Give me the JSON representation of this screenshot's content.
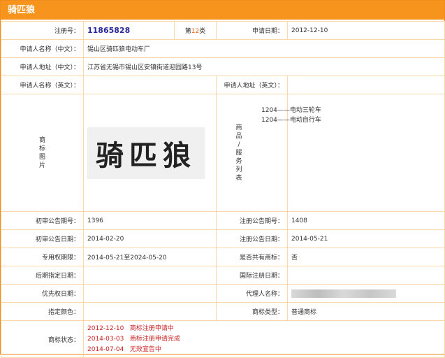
{
  "title": "骑匹狼",
  "fields": {
    "reg_no_label": "注册号：",
    "reg_no": "11865828",
    "class_prefix": "第",
    "class_num": "12",
    "class_suffix": "类",
    "app_date_label": "申请日期：",
    "app_date": "2012-12-10",
    "applicant_cn_label": "申请人名称（中文）：",
    "applicant_cn": "锡山区骑匹狼电动车厂",
    "address_cn_label": "申请人地址（中文）：",
    "address_cn": "江苏省无锡市锡山区安镇街道迎园路13号",
    "applicant_en_label": "申请人名称（英文）：",
    "applicant_en": "",
    "address_en_label": "申请人地址（英文）：",
    "address_en": "",
    "trademark_image_label": [
      "商",
      "标",
      "图",
      "片"
    ],
    "trademark_text": "骑匹狼",
    "goods_label": [
      "商",
      "品",
      "/",
      "服",
      "务",
      "列",
      "表"
    ],
    "goods": [
      "1204——电动三轮车",
      "1204——电动自行车"
    ],
    "prelim_no_label": "初审公告期号：",
    "prelim_no": "1396",
    "reg_pub_no_label": "注册公告期号：",
    "reg_pub_no": "1408",
    "prelim_date_label": "初审公告日期：",
    "prelim_date": "2014-02-20",
    "reg_pub_date_label": "注册公告日期：",
    "reg_pub_date": "2014-05-21",
    "exclusive_label": "专用权期限：",
    "exclusive": "2014-05-21至2024-05-20",
    "shared_label": "是否共有商标：",
    "shared": "否",
    "later_date_label": "后期指定日期：",
    "later_date": "",
    "intl_date_label": "国际注册日期：",
    "intl_date": "",
    "priority_label": "优先权日期：",
    "priority": "",
    "agent_label": "代理人名称：",
    "color_label": "指定颜色：",
    "color": "",
    "tm_type_label": "商标类型：",
    "tm_type": "普通商标",
    "status_label": "商标状态：",
    "status": [
      {
        "date": "2012-12-10",
        "text": "商标注册申请中"
      },
      {
        "date": "2014-03-03",
        "text": "商标注册申请完成"
      },
      {
        "date": "2014-07-04",
        "text": "无效宣告中"
      }
    ]
  },
  "colors": {
    "header_bg": "#f7941d",
    "border": "#f8d7a8",
    "status": "#cc2222",
    "class_num": "#e8600a",
    "reg_no": "#2a2a9a"
  }
}
